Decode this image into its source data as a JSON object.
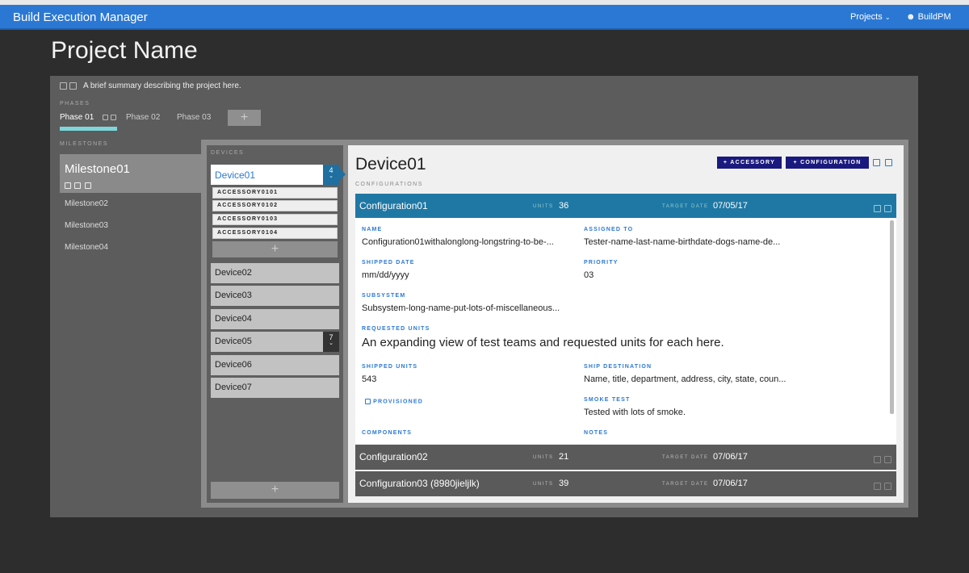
{
  "header": {
    "title": "Build Execution Manager",
    "projects": "Projects",
    "user": "BuildPM"
  },
  "project": {
    "title": "Project Name",
    "summary": "A brief summary describing the project here."
  },
  "phases": {
    "label": "PHASES",
    "tabs": [
      "Phase 01",
      "Phase 02",
      "Phase 03"
    ],
    "add": "+"
  },
  "milestones": {
    "label": "MILESTONES",
    "items": [
      "Milestone01",
      "Milestone02",
      "Milestone03",
      "Milestone04"
    ]
  },
  "devices": {
    "label": "DEVICES",
    "selected": "Device01",
    "selected_count": "4",
    "accessories": [
      "ACCESSORY0101",
      "ACCESSORY0102",
      "ACCESSORY0103",
      "ACCESSORY0104"
    ],
    "others": [
      "Device02",
      "Device03",
      "Device04",
      "Device05",
      "Device06",
      "Device07"
    ],
    "device05_count": "7",
    "add": "+"
  },
  "detail": {
    "title": "Device01",
    "accessory_btn": "+  ACCESSORY",
    "configuration_btn": "+  CONFIGURATION",
    "configs_label": "CONFIGURATIONS",
    "configs": [
      {
        "name": "Configuration01",
        "units_label": "UNITS",
        "units": "36",
        "date_label": "TARGET DATE",
        "date": "07/05/17"
      },
      {
        "name": "Configuration02",
        "units_label": "UNITS",
        "units": "21",
        "date_label": "TARGET DATE",
        "date": "07/06/17"
      },
      {
        "name": "Configuration03 (8980jieljlk)",
        "units_label": "UNITS",
        "units": "39",
        "date_label": "TARGET DATE",
        "date": "07/06/17"
      }
    ],
    "fields": {
      "name_k": "NAME",
      "name_v": "Configuration01withalonglong-longstring-to-be-...",
      "assigned_k": "ASSIGNED TO",
      "assigned_v": "Tester-name-last-name-birthdate-dogs-name-de...",
      "shipped_date_k": "SHIPPED DATE",
      "shipped_date_v": "mm/dd/yyyy",
      "priority_k": "PRIORITY",
      "priority_v": "03",
      "subsystem_k": "SUBSYSTEM",
      "subsystem_v": "Subsystem-long-name-put-lots-of-miscellaneous...",
      "requested_k": "REQUESTED UNITS",
      "requested_v": "An expanding view of test teams and requested units for each here.",
      "shipped_units_k": "SHIPPED UNITS",
      "shipped_units_v": "543",
      "dest_k": "SHIP DESTINATION",
      "dest_v": "Name, title, department, address, city, state, coun...",
      "provisioned": "PROVISIONED",
      "smoke_k": "SMOKE TEST",
      "smoke_v": "Tested with lots of smoke.",
      "components_k": "COMPONENTS",
      "notes_k": "NOTES"
    }
  },
  "colors": {
    "header": "#2b78d4",
    "accent_tab": "#7fd6da",
    "config_active": "#1f78a4",
    "buttons": "#1a1a7e"
  }
}
